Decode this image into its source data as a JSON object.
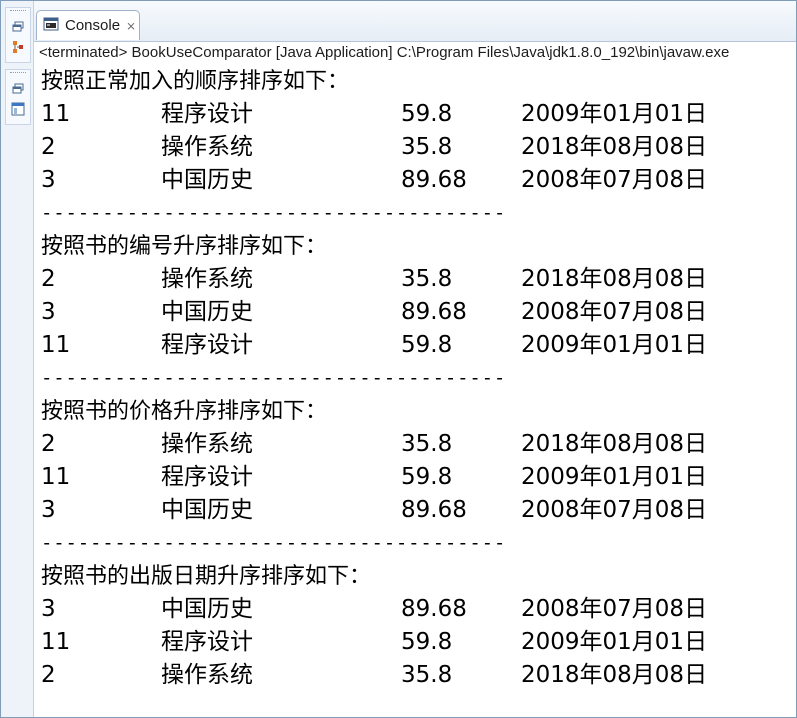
{
  "tab": {
    "label": "Console",
    "close_glyph": "⨯"
  },
  "status_line": "<terminated> BookUseComparator [Java Application] C:\\Program Files\\Java\\jdk1.8.0_192\\bin\\javaw.exe",
  "sidebar": {
    "icons": [
      "restore-icon",
      "sort-icon",
      "restore-icon",
      "console-view-icon"
    ]
  },
  "separator": "--------------------------------------",
  "sections": [
    {
      "heading": "按照正常加入的顺序排序如下：",
      "rows": [
        {
          "id": "11",
          "name": "程序设计",
          "price": "59.8",
          "date": "2009年01月01日"
        },
        {
          "id": "2",
          "name": "操作系统",
          "price": "35.8",
          "date": "2018年08月08日"
        },
        {
          "id": "3",
          "name": "中国历史",
          "price": "89.68",
          "date": "2008年07月08日"
        }
      ]
    },
    {
      "heading": "按照书的编号升序排序如下：",
      "rows": [
        {
          "id": "2",
          "name": "操作系统",
          "price": "35.8",
          "date": "2018年08月08日"
        },
        {
          "id": "3",
          "name": "中国历史",
          "price": "89.68",
          "date": "2008年07月08日"
        },
        {
          "id": "11",
          "name": "程序设计",
          "price": "59.8",
          "date": "2009年01月01日"
        }
      ]
    },
    {
      "heading": "按照书的价格升序排序如下：",
      "rows": [
        {
          "id": "2",
          "name": "操作系统",
          "price": "35.8",
          "date": "2018年08月08日"
        },
        {
          "id": "11",
          "name": "程序设计",
          "price": "59.8",
          "date": "2009年01月01日"
        },
        {
          "id": "3",
          "name": "中国历史",
          "price": "89.68",
          "date": "2008年07月08日"
        }
      ]
    },
    {
      "heading": "按照书的出版日期升序排序如下：",
      "rows": [
        {
          "id": "3",
          "name": "中国历史",
          "price": "89.68",
          "date": "2008年07月08日"
        },
        {
          "id": "11",
          "name": "程序设计",
          "price": "59.8",
          "date": "2009年01月01日"
        },
        {
          "id": "2",
          "name": "操作系统",
          "price": "35.8",
          "date": "2018年08月08日"
        }
      ]
    }
  ]
}
